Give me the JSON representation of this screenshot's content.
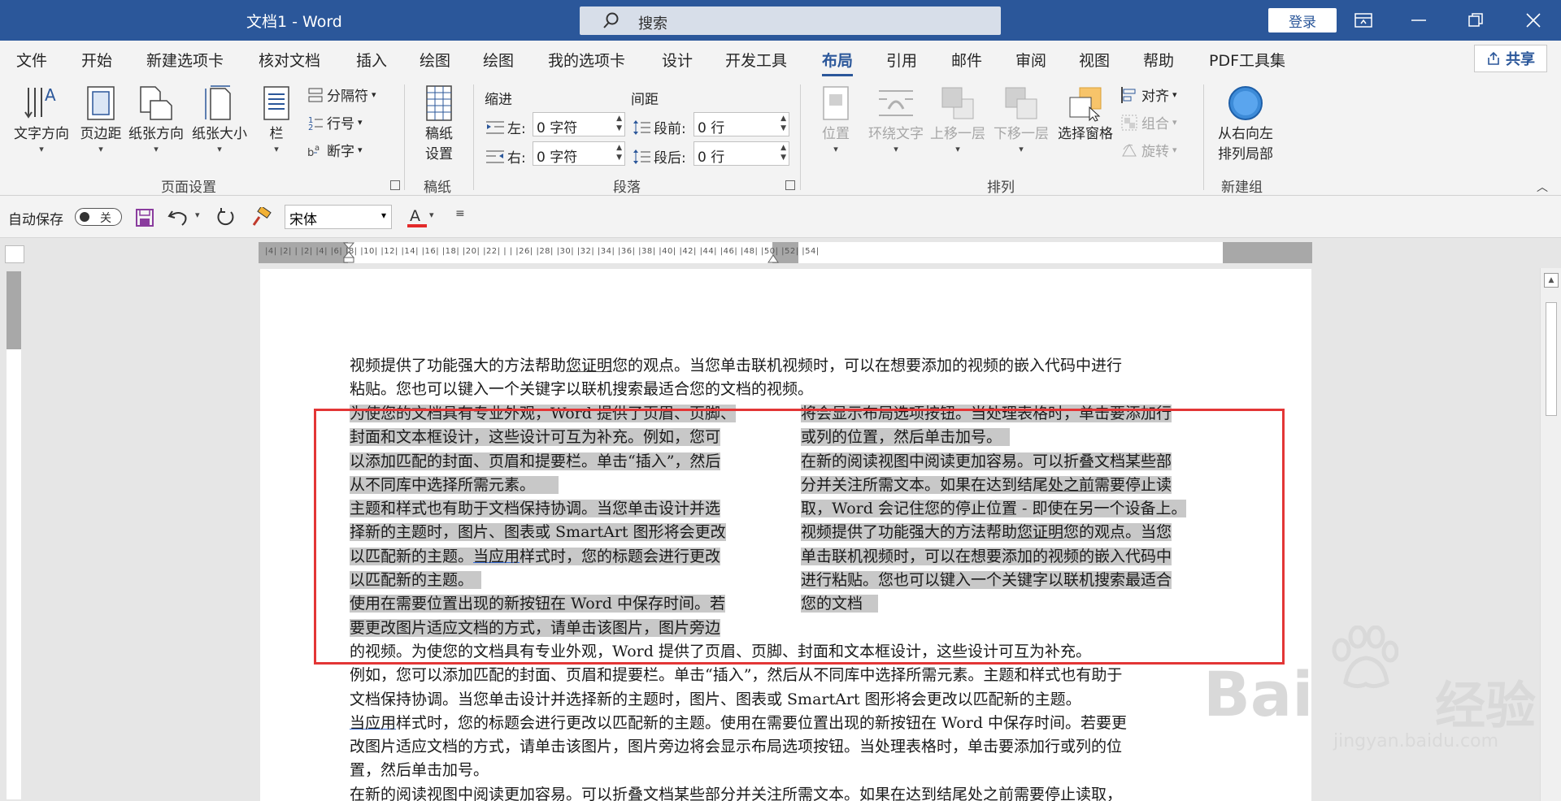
{
  "app": {
    "title": "文档1  -  Word",
    "search_placeholder": "搜索",
    "login_label": "登录"
  },
  "tabs": [
    "文件",
    "开始",
    "新建选项卡",
    "核对文档",
    "插入",
    "绘图",
    "绘图",
    "我的选项卡",
    "设计",
    "开发工具",
    "布局",
    "引用",
    "邮件",
    "审阅",
    "视图",
    "帮助",
    "PDF工具集"
  ],
  "active_tab": "布局",
  "share_label": "共享",
  "ribbon": {
    "page_setup": {
      "text_direction": "文字方向",
      "margins": "页边距",
      "orientation": "纸张方向",
      "size": "纸张大小",
      "columns": "栏",
      "breaks": "分隔符",
      "line_numbers": "行号",
      "hyphenation": "断字",
      "group_label": "页面设置"
    },
    "manuscript": {
      "label": "稿纸设置",
      "label1": "稿纸",
      "label2": "设置",
      "group_label": "稿纸"
    },
    "paragraph": {
      "indent_title": "缩进",
      "spacing_title": "间距",
      "left_label": "左:",
      "left_value": "0 字符",
      "right_label": "右:",
      "right_value": "0 字符",
      "before_label": "段前:",
      "before_value": "0 行",
      "after_label": "段后:",
      "after_value": "0 行",
      "group_label": "段落"
    },
    "arrange": {
      "position": "位置",
      "wrap_text": "环绕文字",
      "bring_forward": "上移一层",
      "send_backward": "下移一层",
      "selection_pane": "选择窗格",
      "align": "对齐",
      "group": "组合",
      "rotate": "旋转",
      "group_label": "排列"
    },
    "new_group": {
      "rtl_line1": "从右向左",
      "rtl_line2": "排列局部",
      "group_label": "新建组"
    }
  },
  "qat": {
    "autosave_label": "自动保存",
    "autosave_state": "关",
    "font_name": "宋体"
  },
  "ruler_numbers": "|4| |2| |  |2| |4| |6| |8| |10| |12| |14| |16| |18| |20| |22| |  |  |26| |28| |30| |32| |34| |36| |38| |40| |42| |44| |46| |48| |50| |52| |54|",
  "document": {
    "top_lines": [
      [
        "视频提供了功能强大的方法帮助",
        "您证明",
        "您的观点。当您单击联机视频时，可以在想要添加的视频的嵌入代码中进行"
      ],
      "粘贴。您也可以键入一个关键字以联机搜索最适合您的文档的视频。"
    ],
    "left_column": [
      "为使您的文档具有专业外观，Word 提供了页眉、页脚、",
      "封面和文本框设计，这些设计可互为补充。例如，您可",
      "以添加匹配的封面、页眉和提要栏。单击“插入”，然后",
      "从不同库中选择所需元素。",
      "主题和样式也有助于文档保持协调。当您单击设计并选",
      "择新的主题时，图片、图表或 SmartArt 图形将会更改",
      [
        "以匹配新的主题。",
        "当应用",
        "样式时，您的标题会进行更改"
      ],
      "以匹配新的主题。",
      "使用在需要位置出现的新按钮在 Word 中保存时间。若",
      "要更改图片适应文档的方式，请单击该图片，图片旁边"
    ],
    "right_column": [
      "将会显示布局选项按钮。当处理表格时，单击要添加行",
      "或列的位置，然后单击加号。",
      "在新的阅读视图中阅读更加容易。可以折叠文档某些部",
      [
        "分并关注所需文本。如果在达到结尾",
        "处之前",
        "需要停止读"
      ],
      "取，Word 会记住您的停止位置 - 即使在另一个设备上。",
      [
        "视频提供了功能强大的方法帮助",
        "您证明",
        "您的观点。当您"
      ],
      "单击联机视频时，可以在想要添加的视频的嵌入代码中",
      "进行粘贴。您也可以键入一个关键字以联机搜索最适合",
      "您的文档"
    ],
    "bottom_lines": [
      "的视频。为使您的文档具有专业外观，Word 提供了页眉、页脚、封面和文本框设计，这些设计可互为补充。",
      "例如，您可以添加匹配的封面、页眉和提要栏。单击“插入”，然后从不同库中选择所需元素。主题和样式也有助于",
      "文档保持协调。当您单击设计并选择新的主题时，图片、图表或 SmartArt 图形将会更改以匹配新的主题。",
      [
        "当应用",
        "样式时，您的标题会进行更改以匹配新的主题。使用在需要位置出现的新按钮在 Word 中保存时间。若要更"
      ],
      "改图片适应文档的方式，请单击该图片，图片旁边将会显示布局选项按钮。当处理表格时，单击要添加行或列的位",
      "置，然后单击加号。",
      "在新的阅读视图中阅读更加容易。可以折叠文档某些部分并关注所需文本。如果在达到结尾处之前需要停止读取，"
    ]
  },
  "watermark": {
    "brand": "Bai",
    "brand_cn": "经验",
    "url": "jingyan.baidu.com"
  },
  "colors": {
    "title_bar": "#2b579a",
    "selection_box": "#e33636",
    "highlight": "#c8c8c8"
  }
}
